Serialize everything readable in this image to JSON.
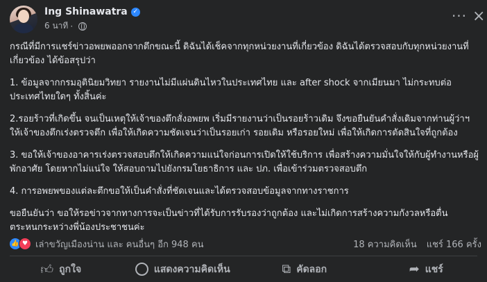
{
  "post": {
    "author": "Ing Shinawatra",
    "time": "6 นาที",
    "paragraphs": [
      "กรณีที่มีการแชร์ข่าวอพยพออกจากตึกขณะนี้  ดิฉันได้เช็คจากทุกหน่วยงานที่เกี่ยวข้อง ดิฉันได้ตรวจสอบกับทุกหน่วยงานที่เกี่ยวข้อง ได้ข้อสรุปว่า",
      "1. ข้อมูลจากกรมอุตินิยมวิทยา รายงานไม่มีแผ่นดินไหวในประเทศไทย  และ after shock จากเมียนมา ไม่กระทบต่อประเทศไทยใดๆ ทั้งสิ้นค่ะ",
      "2.รอยร้าวที่เกิดขึ้น จนเป็นเหตุให้เจ้าของตึกสั่งอพยพ เริ่มมีรายงานว่าเป็นรอยร้าวเดิม จึงขอยืนยันคำสั่งเดิมจากท่านผู้ว่าฯ ให้เจ้าของตึกเร่งตรวจตึก เพื่อให้เกิดความชัดเจนว่าเป็นรอยเก่า รอยเดิม หรือรอยใหม่ เพื่อให้เกิดการตัดสินใจที่ถูกต้อง",
      "3. ขอให้เจ้าของอาคารเร่งตรวจสอบตึกให้เกิดความแน่ใจก่อนการเปิดให้ใช้บริการ เพื่อสร้างความมั่นใจให้กับผู้ทำงานหรือผู้พักอาศัย โดยหากไม่แน่ใจ ให้สอบถามไปยังกรมโยธาธิการ และ ปภ. เพื่อเข้าร่วมตรวจสอบตึก",
      "4. การอพยพของแต่ละตึกขอให้เป็นคำสั่งที่ชัดเจนและได้ตรวจสอบข้อมูลจากทางราชการ",
      "ขอยืนยันว่า ขอให้รอข่าวจากทางการจะเป็นข่าวที่ได้รับการรับรองว่าถูกต้อง และไม่เกิดการสร้างความกังวลหรือตื่นตระหนกระหว่างพี่น้องประชาชนค่ะ"
    ],
    "reactions_text": "เล่าขวัญเมืองน่าน และ คนอื่นๆ อีก 948 คน",
    "comments_text": "18 ความคิดเห็น",
    "shares_text": "แชร์ 166 ครั้ง"
  },
  "actions": {
    "like": "ถูกใจ",
    "comment": "แสดงความคิดเห็น",
    "copy": "คัดลอก",
    "share": "แชร์"
  },
  "colors": {
    "background": "#242526",
    "text": "#e4e6eb",
    "muted": "#b0b3b8",
    "accent": "#2d88ff"
  },
  "icons": [
    "verified-badge-icon",
    "globe-icon",
    "more-options-icon",
    "close-icon",
    "like-reaction-icon",
    "love-reaction-icon",
    "thumbs-up-icon",
    "comment-icon",
    "copy-icon",
    "share-icon"
  ]
}
